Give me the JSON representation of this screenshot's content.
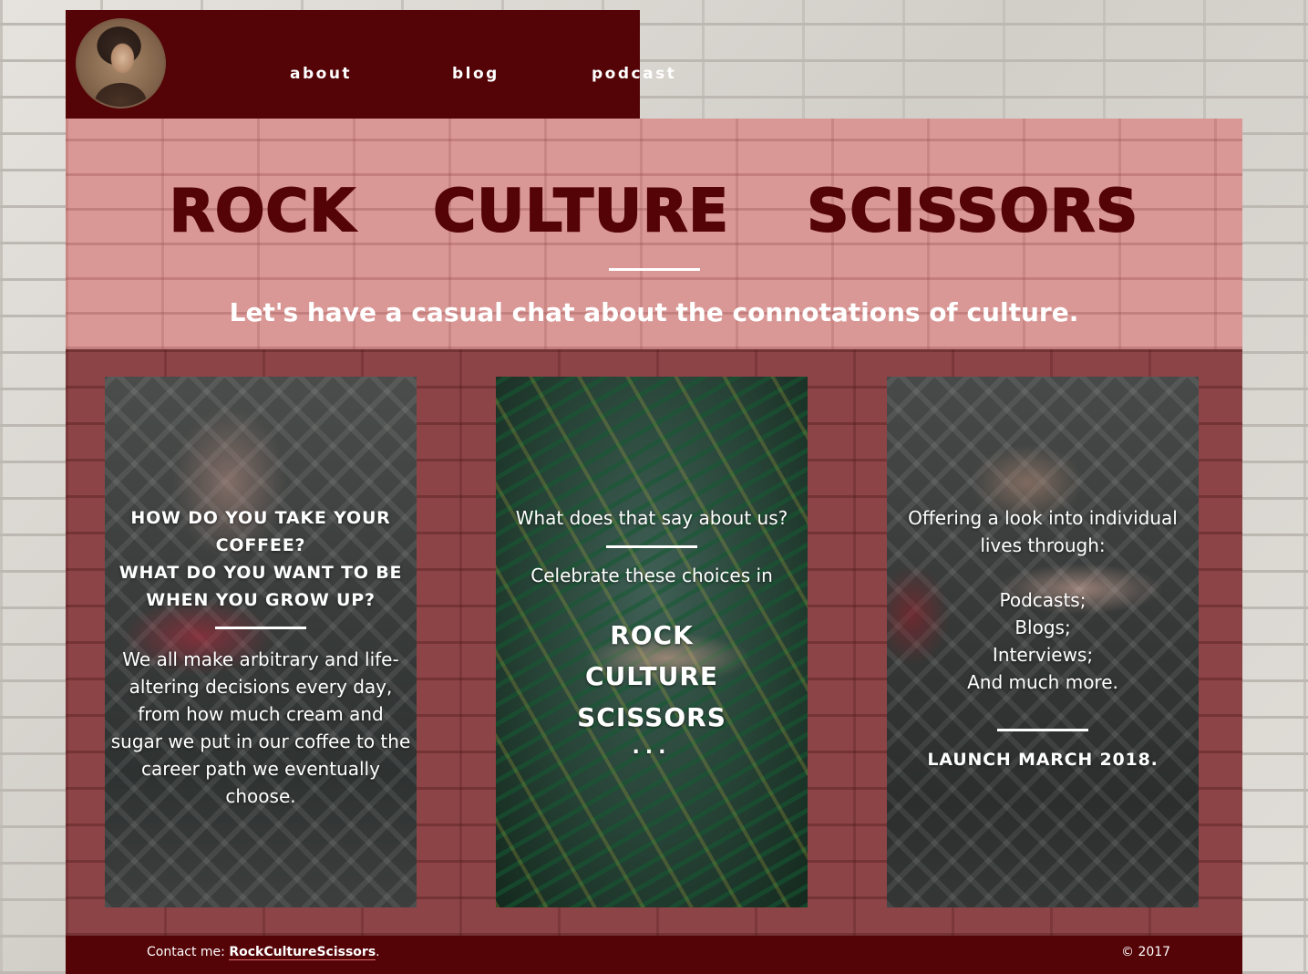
{
  "nav": {
    "links": [
      {
        "label": "about"
      },
      {
        "label": "blog"
      },
      {
        "label": "podcast"
      }
    ]
  },
  "hero": {
    "title": "ROCK CULTURE SCISSORS",
    "subtitle": "Let's have a casual chat about the connotations of culture."
  },
  "cards": {
    "card1": {
      "heading_line1": "HOW DO YOU TAKE YOUR COFFEE?",
      "heading_line2": "WHAT DO YOU WANT TO BE WHEN YOU GROW UP?",
      "body": "We all make arbitrary and life-altering decisions every day, from how much cream and sugar we put in our coffee to the career path we eventually choose."
    },
    "card2": {
      "question": "What does that say about us?",
      "celebrate": "Celebrate these choices in",
      "brand": [
        "ROCK",
        "CULTURE",
        "SCISSORS"
      ],
      "dots": "..."
    },
    "card3": {
      "intro": "Offering a look into individual lives through:",
      "items": [
        "Podcasts;",
        "Blogs;",
        "Interviews;",
        "And much more."
      ],
      "launch": "LAUNCH MARCH 2018."
    }
  },
  "footer": {
    "contact_prefix": "Contact me: ",
    "contact_link": "RockCultureScissors",
    "contact_suffix": ".",
    "copyright": "© 2017"
  },
  "colors": {
    "brand_dark": "#540306",
    "hero_pink": "#d99896",
    "content_maroon": "#8d4446",
    "text_light": "#ffffff"
  }
}
